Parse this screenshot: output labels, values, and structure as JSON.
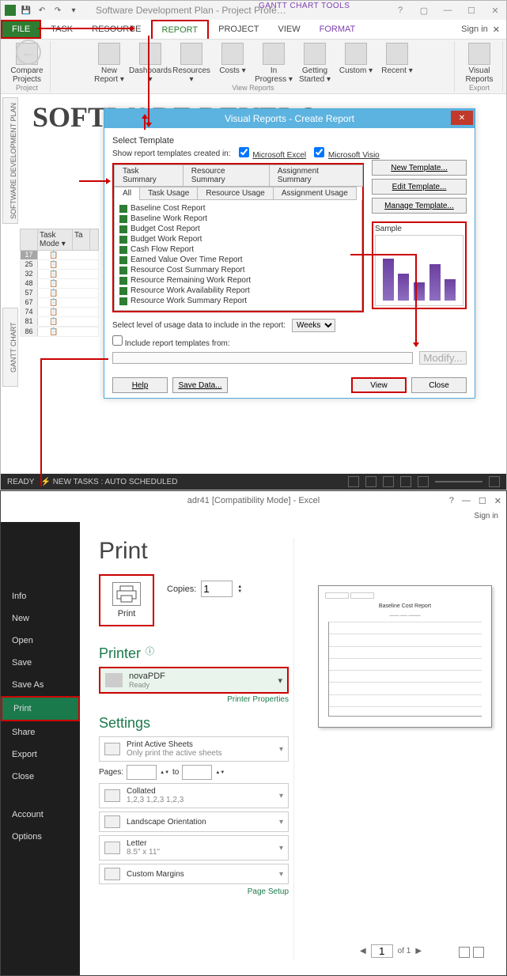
{
  "project": {
    "title": "Software Development Plan - Project Profe…",
    "tool_context": "GANTT CHART TOOLS",
    "tabs": {
      "file": "FILE",
      "task": "TASK",
      "resource": "RESOURCE",
      "report": "REPORT",
      "project_tab": "PROJECT",
      "view": "VIEW",
      "format": "FORMAT"
    },
    "signin": "Sign in",
    "ribbon": {
      "compare": "Compare Projects",
      "new_report": "New Report ▾",
      "dashboards": "Dashboards ▾",
      "resources": "Resources ▾",
      "costs": "Costs ▾",
      "in_progress": "In Progress ▾",
      "getting_started": "Getting Started ▾",
      "custom": "Custom ▾",
      "recent": "Recent ▾",
      "visual_reports": "Visual Reports",
      "group_project": "Project",
      "group_view": "View Reports",
      "group_export": "Export"
    },
    "doc_heading": "SOFTWARE DEVELO",
    "side_label1": "SOFTWARE DEVELOPMENT PLAN",
    "side_label2": "GANTT CHART",
    "task_col1": "Task Mode ▾",
    "task_col2": "Ta",
    "task_rows": [
      "17",
      "25",
      "32",
      "48",
      "57",
      "67",
      "74",
      "81",
      "",
      "86"
    ],
    "dialog": {
      "title": "Visual Reports - Create Report",
      "select_template": "Select Template",
      "show_templates": "Show report templates created in:",
      "chk_excel": "Microsoft Excel",
      "chk_visio": "Microsoft Visio",
      "tabs_row1": [
        "Task Summary",
        "Resource Summary",
        "Assignment Summary"
      ],
      "tabs_row2": [
        "All",
        "Task Usage",
        "Resource Usage",
        "Assignment Usage"
      ],
      "list": [
        "Baseline Cost Report",
        "Baseline Work Report",
        "Budget Cost Report",
        "Budget Work Report",
        "Cash Flow Report",
        "Earned Value Over Time Report",
        "Resource Cost Summary Report",
        "Resource Remaining Work Report",
        "Resource Work Availability Report",
        "Resource Work Summary Report"
      ],
      "new_template": "New Template...",
      "edit_template": "Edit Template...",
      "manage_template": "Manage Template...",
      "sample": "Sample",
      "level_label": "Select level of usage data to include in the report:",
      "level_value": "Weeks",
      "include_label": "Include report templates from:",
      "modify": "Modify...",
      "help": "Help",
      "save_data": "Save Data...",
      "view": "View",
      "close": "Close"
    },
    "status": {
      "ready": "READY",
      "new_tasks": "NEW TASKS : AUTO SCHEDULED"
    }
  },
  "excel": {
    "title": "adr41  [Compatibility Mode] - Excel",
    "signin": "Sign in",
    "nav": [
      "Info",
      "New",
      "Open",
      "Save",
      "Save As",
      "Print",
      "Share",
      "Export",
      "Close",
      "",
      "Account",
      "Options"
    ],
    "print_heading": "Print",
    "print_btn": "Print",
    "copies": "Copies:",
    "copies_val": "1",
    "printer": "Printer",
    "printer_name": "novaPDF",
    "printer_status": "Ready",
    "printer_props": "Printer Properties",
    "settings": "Settings",
    "s_active": "Print Active Sheets",
    "s_active_sub": "Only print the active sheets",
    "pages": "Pages:",
    "to": "to",
    "s_collated": "Collated",
    "s_collated_sub": "1,2,3   1,2,3   1,2,3",
    "s_orient": "Landscape Orientation",
    "s_paper": "Letter",
    "s_paper_sub": "8.5\" x 11\"",
    "s_margins": "Custom Margins",
    "page_setup": "Page Setup",
    "preview_title": "Baseline Cost Report",
    "page_current": "1",
    "page_total": "of 1"
  }
}
